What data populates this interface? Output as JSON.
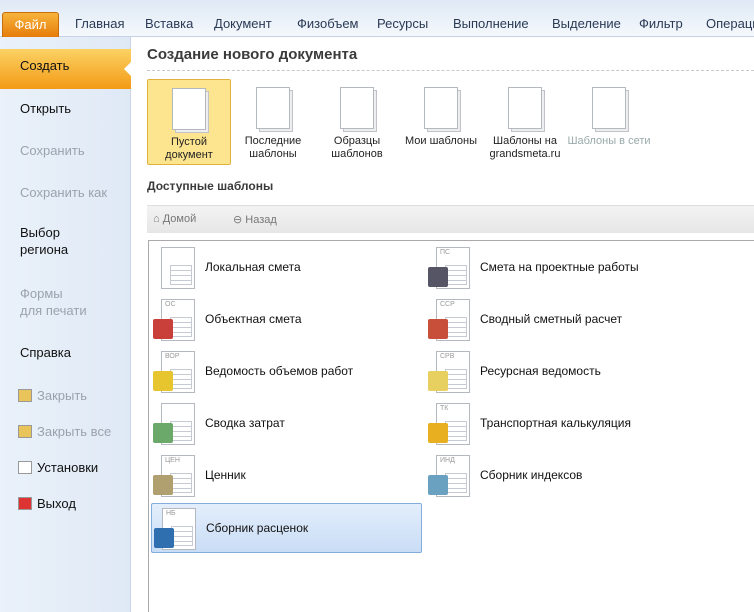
{
  "tabs": [
    "Файл",
    "Главная",
    "Вставка",
    "Документ",
    "Физобъем",
    "Ресурсы",
    "Выполнение",
    "Выделение",
    "Фильтр",
    "Операции"
  ],
  "sidebar": {
    "items": [
      {
        "label": "Создать",
        "state": "selected"
      },
      {
        "label": "Открыть",
        "state": "normal"
      },
      {
        "label": "Сохранить",
        "state": "disabled"
      },
      {
        "label": "Сохранить как",
        "state": "disabled"
      },
      {
        "label": "Выбор\nрегиона",
        "state": "normal"
      },
      {
        "label": "Формы\nдля печати",
        "state": "disabled"
      },
      {
        "label": "Справка",
        "state": "normal"
      },
      {
        "label": "Закрыть",
        "state": "disabled",
        "icon": "folder-icon"
      },
      {
        "label": "Закрыть все",
        "state": "disabled",
        "icon": "folders-icon"
      },
      {
        "label": "Установки",
        "state": "normal",
        "icon": "settings-icon"
      },
      {
        "label": "Выход",
        "state": "normal",
        "icon": "exit-icon"
      }
    ]
  },
  "main": {
    "title": "Создание нового документа",
    "templates": [
      {
        "label": "Пустой документ",
        "icon": "blank-document-icon",
        "selected": true
      },
      {
        "label": "Последние шаблоны",
        "icon": "recent-clock-icon"
      },
      {
        "label": "Образцы шаблонов",
        "icon": "sample-computer-icon"
      },
      {
        "label": "Мои шаблоны",
        "icon": "user-icon"
      },
      {
        "label": "Шаблоны на grandsmeta.ru",
        "icon": "web-icon"
      },
      {
        "label": "Шаблоны в сети",
        "icon": "network-folder-icon",
        "disabled": true
      }
    ],
    "available_title": "Доступные шаблоны",
    "nav": {
      "home": "Домой",
      "back": "Назад"
    },
    "items": [
      {
        "label": "Локальная смета",
        "code": "",
        "color": ""
      },
      {
        "label": "Смета на проектные работы",
        "code": "ПС",
        "color": "#556"
      },
      {
        "label": "Объектная смета",
        "code": "ОС",
        "color": "#c9403a"
      },
      {
        "label": "Сводный сметный расчет",
        "code": "ССР",
        "color": "#c8503a"
      },
      {
        "label": "Ведомость объемов работ",
        "code": "ВОР",
        "color": "#e6c52e"
      },
      {
        "label": "Ресурсная ведомость",
        "code": "СРВ",
        "color": "#e8d060"
      },
      {
        "label": "Сводка затрат",
        "code": "",
        "color": "#6aa96a"
      },
      {
        "label": "Транспортная калькуляция",
        "code": "ТК",
        "color": "#e8b020"
      },
      {
        "label": "Ценник",
        "code": "ЦЕН",
        "color": "#b0a070"
      },
      {
        "label": "Сборник индексов",
        "code": "ИНД",
        "color": "#6aa0c0"
      },
      {
        "label": "Сборник расценок",
        "code": "НБ",
        "color": "#2f6fb0",
        "selected": true
      }
    ]
  }
}
